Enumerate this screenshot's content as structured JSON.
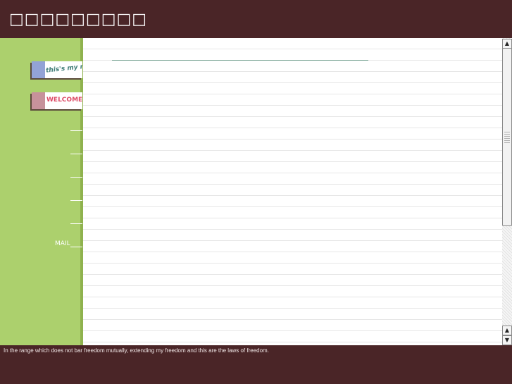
{
  "header": {
    "title": "□□□□□□□□□"
  },
  "sidebar": {
    "tabs": [
      {
        "label": "this's my note",
        "swatch": "#93a3d6",
        "text_color": "#3f7d77"
      },
      {
        "label": "WELCOME!",
        "swatch": "#c7929b",
        "text_color": "#dd4b66"
      }
    ],
    "nav_links": [
      "",
      "",
      "",
      "",
      "",
      "MAIL"
    ]
  },
  "scrollbar": {
    "up_icon": "arrow-up-icon",
    "down_icon": "arrow-down-icon"
  },
  "footer": {
    "text": "In the range which does not bar freedom mutually, extending my freedom and this are the laws of freedom."
  },
  "colors": {
    "header_bg": "#4a2527",
    "sidebar_bg": "#acd06d",
    "content_bg": "#ffffff",
    "rule_color": "#6d9c8a"
  }
}
